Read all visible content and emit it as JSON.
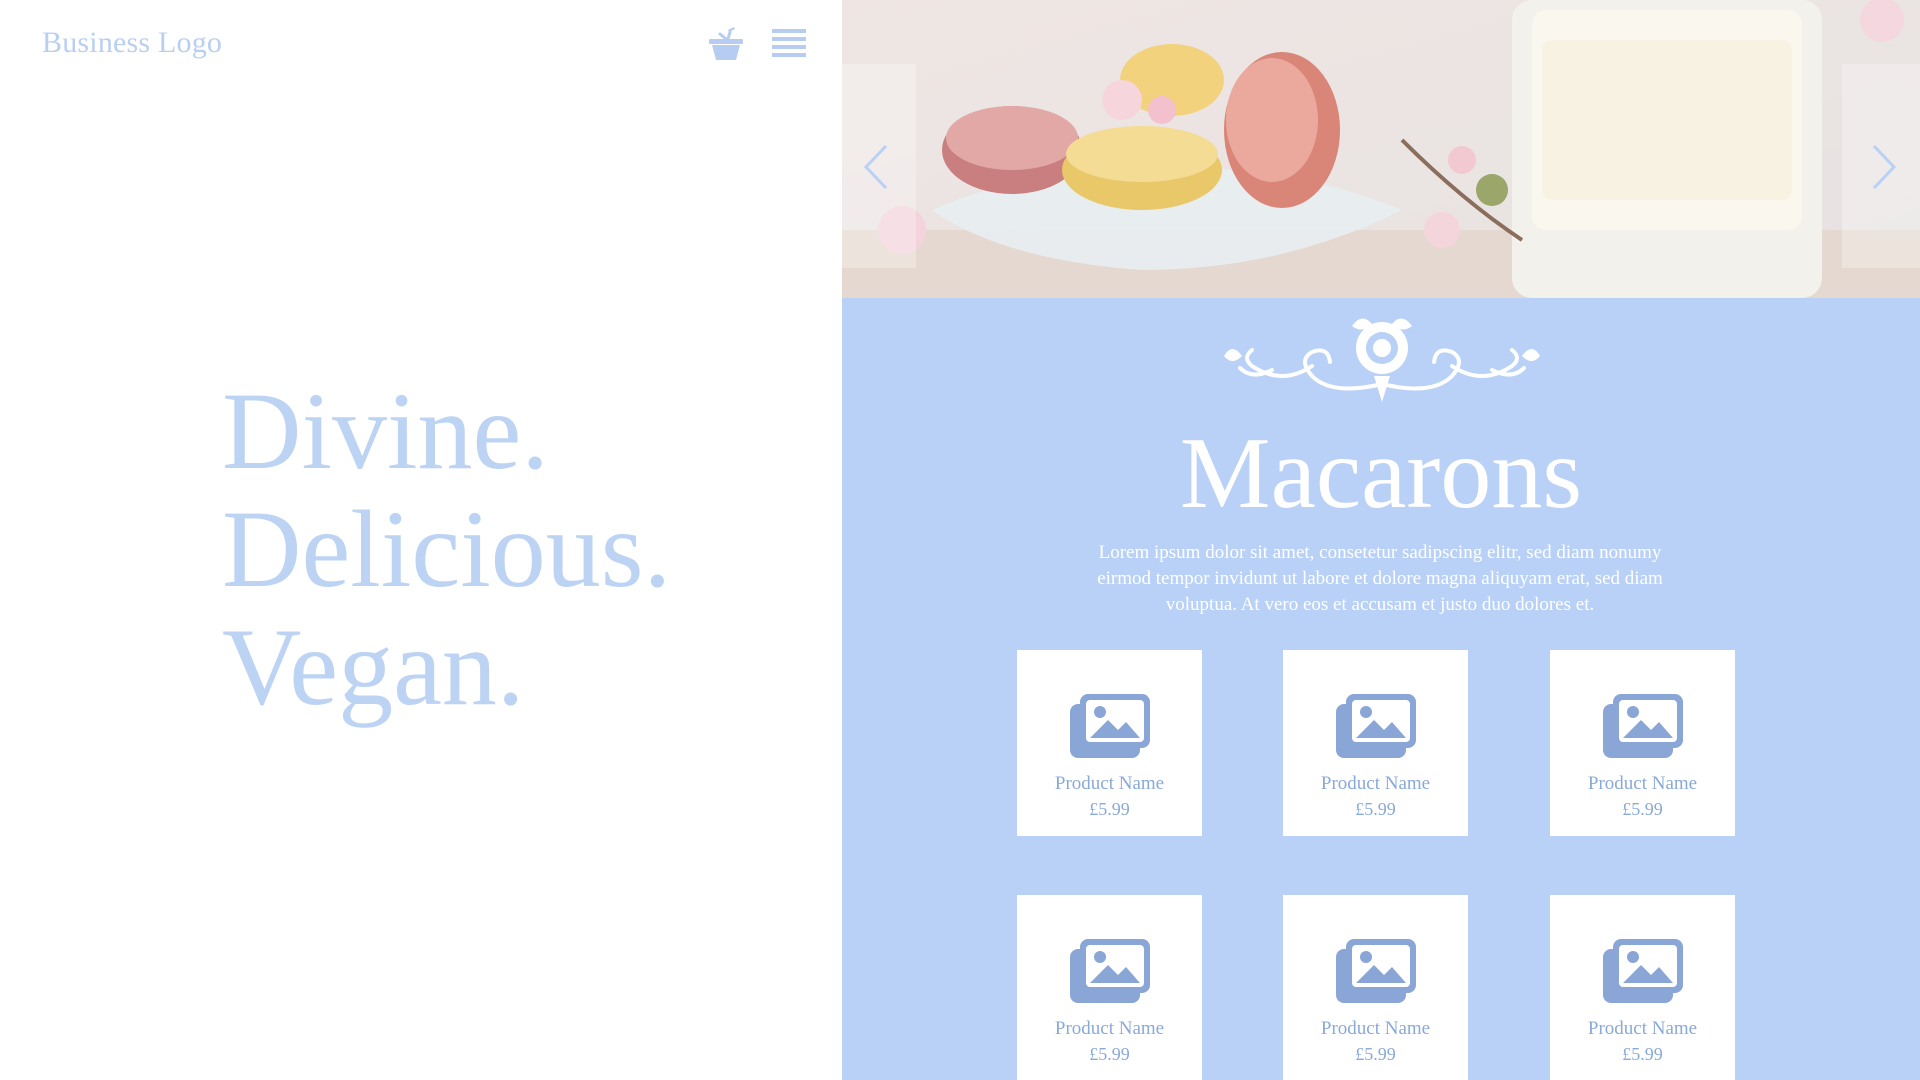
{
  "header": {
    "logo_text": "Business Logo",
    "basket_icon": "basket-icon",
    "menu_icon": "hamburger-menu-icon"
  },
  "tagline": [
    "Divine.",
    "Delicious.",
    "Vegan."
  ],
  "hero": {
    "image_description": "macarons-and-glass-of-milk-photo",
    "prev_icon": "chevron-left-icon",
    "next_icon": "chevron-right-icon"
  },
  "section": {
    "ornament_icon": "rose-flourish-ornament",
    "title": "Macarons",
    "intro": "Lorem ipsum dolor sit amet, consetetur sadipscing elitr, sed diam nonumy eirmod tempor invidunt ut labore et dolore magna aliquyam erat, sed diam voluptua. At vero eos et accusam et justo duo dolores et."
  },
  "products": [
    {
      "name": "Product Name",
      "price": "£5.99",
      "icon": "image-placeholder-icon"
    },
    {
      "name": "Product Name",
      "price": "£5.99",
      "icon": "image-placeholder-icon"
    },
    {
      "name": "Product Name",
      "price": "£5.99",
      "icon": "image-placeholder-icon"
    },
    {
      "name": "Product Name",
      "price": "£5.99",
      "icon": "image-placeholder-icon"
    },
    {
      "name": "Product Name",
      "price": "£5.99",
      "icon": "image-placeholder-icon"
    },
    {
      "name": "Product Name",
      "price": "£5.99",
      "icon": "image-placeholder-icon"
    }
  ],
  "colors": {
    "accent_blue": "#b9d1f6",
    "text_blue": "#89a9d9",
    "icon_blue": "#8aa6d6"
  }
}
